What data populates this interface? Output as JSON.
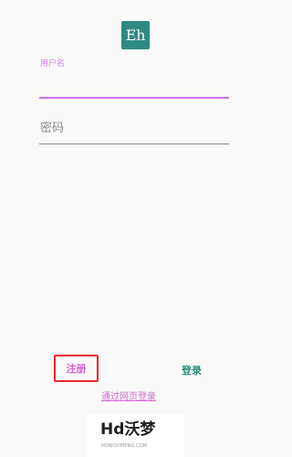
{
  "app": {
    "logo_text": "Eh",
    "logo_color": "#2f8a80"
  },
  "login_form": {
    "username_label": "用户名",
    "password_placeholder": "密码"
  },
  "actions": {
    "register_label": "注册",
    "login_label": "登录",
    "web_login_label": "通过网页登录"
  },
  "watermark": {
    "mark": "Hd沃梦",
    "site": "HDWOOMENG.COM"
  }
}
